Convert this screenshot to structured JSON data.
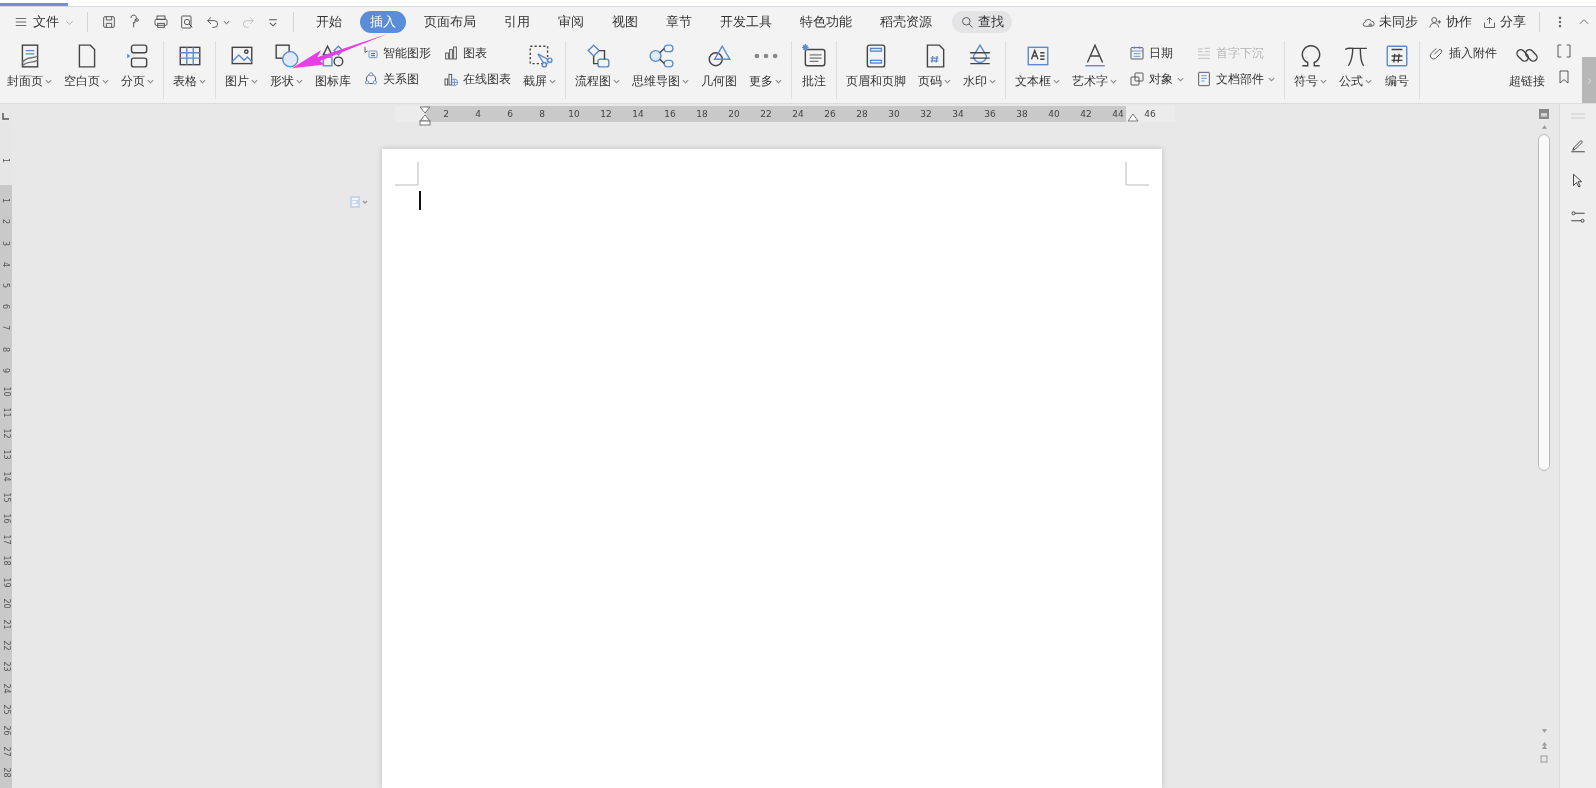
{
  "menu": {
    "label": "文件"
  },
  "tabs": [
    {
      "label": "开始",
      "selected": false
    },
    {
      "label": "插入",
      "selected": true
    },
    {
      "label": "页面布局",
      "selected": false
    },
    {
      "label": "引用",
      "selected": false
    },
    {
      "label": "审阅",
      "selected": false
    },
    {
      "label": "视图",
      "selected": false
    },
    {
      "label": "章节",
      "selected": false
    },
    {
      "label": "开发工具",
      "selected": false
    },
    {
      "label": "特色功能",
      "selected": false
    },
    {
      "label": "稻壳资源",
      "selected": false
    }
  ],
  "search": {
    "label": "查找"
  },
  "account": [
    {
      "label": "未同步"
    },
    {
      "label": "协作"
    },
    {
      "label": "分享"
    }
  ],
  "ribbon": {
    "groups": [
      {
        "items": [
          {
            "kind": "large",
            "label": "封面页",
            "dropdown": true
          },
          {
            "kind": "large",
            "label": "空白页",
            "dropdown": true
          },
          {
            "kind": "large",
            "label": "分页",
            "dropdown": true
          }
        ]
      },
      {
        "items": [
          {
            "kind": "large",
            "label": "表格",
            "dropdown": true
          }
        ]
      },
      {
        "items": [
          {
            "kind": "large",
            "label": "图片",
            "dropdown": true
          },
          {
            "kind": "large",
            "label": "形状",
            "dropdown": true
          },
          {
            "kind": "large",
            "label": "图标库",
            "dropdown": false
          },
          {
            "kind": "stack",
            "items": [
              {
                "label": "智能图形",
                "dropdown": false,
                "disabled": false
              },
              {
                "label": "关系图",
                "dropdown": false,
                "disabled": false
              }
            ]
          },
          {
            "kind": "stack",
            "items": [
              {
                "label": "图表",
                "dropdown": false,
                "disabled": false
              },
              {
                "label": "在线图表",
                "dropdown": false,
                "disabled": false
              }
            ]
          },
          {
            "kind": "large",
            "label": "截屏",
            "dropdown": true
          }
        ]
      },
      {
        "items": [
          {
            "kind": "large",
            "label": "流程图",
            "dropdown": true
          },
          {
            "kind": "large",
            "label": "思维导图",
            "dropdown": true
          },
          {
            "kind": "large",
            "label": "几何图",
            "dropdown": false
          },
          {
            "kind": "large",
            "label": "更多",
            "dropdown": true
          }
        ]
      },
      {
        "items": [
          {
            "kind": "large",
            "label": "批注",
            "dropdown": false
          }
        ]
      },
      {
        "items": [
          {
            "kind": "large",
            "label": "页眉和页脚",
            "dropdown": false
          },
          {
            "kind": "large",
            "label": "页码",
            "dropdown": true
          },
          {
            "kind": "large",
            "label": "水印",
            "dropdown": true
          }
        ]
      },
      {
        "items": [
          {
            "kind": "large",
            "label": "文本框",
            "dropdown": true
          },
          {
            "kind": "large",
            "label": "艺术字",
            "dropdown": true
          },
          {
            "kind": "stack",
            "items": [
              {
                "label": "日期",
                "dropdown": false,
                "disabled": false
              },
              {
                "label": "对象",
                "dropdown": true,
                "disabled": false
              }
            ]
          },
          {
            "kind": "stack",
            "items": [
              {
                "label": "首字下沉",
                "dropdown": false,
                "disabled": true
              },
              {
                "label": "文档部件",
                "dropdown": true,
                "disabled": false
              }
            ]
          }
        ]
      },
      {
        "items": [
          {
            "kind": "large",
            "label": "符号",
            "dropdown": true
          },
          {
            "kind": "large",
            "label": "公式",
            "dropdown": true
          },
          {
            "kind": "large",
            "label": "编号",
            "dropdown": false
          }
        ]
      },
      {
        "items": [
          {
            "kind": "stack",
            "items": [
              {
                "label": "插入附件",
                "dropdown": false,
                "disabled": false
              }
            ]
          },
          {
            "kind": "large",
            "label": "超链接",
            "dropdown": false
          }
        ]
      }
    ]
  },
  "ruler": {
    "marks": [
      "2",
      "4",
      "6",
      "8",
      "10",
      "12",
      "14",
      "16",
      "18",
      "20",
      "22",
      "24",
      "26",
      "28",
      "30",
      "32",
      "34",
      "36",
      "38",
      "40",
      "42",
      "44",
      "46"
    ]
  },
  "vertical_ruler": {
    "marks": [
      "1",
      "1",
      "2",
      "3",
      "4",
      "5",
      "6",
      "7",
      "8",
      "9",
      "10",
      "11",
      "12",
      "13",
      "14",
      "15",
      "16",
      "17",
      "18",
      "19",
      "20",
      "21",
      "22",
      "23",
      "24",
      "25",
      "26",
      "27",
      "28"
    ]
  },
  "document": {
    "cursor": true
  }
}
